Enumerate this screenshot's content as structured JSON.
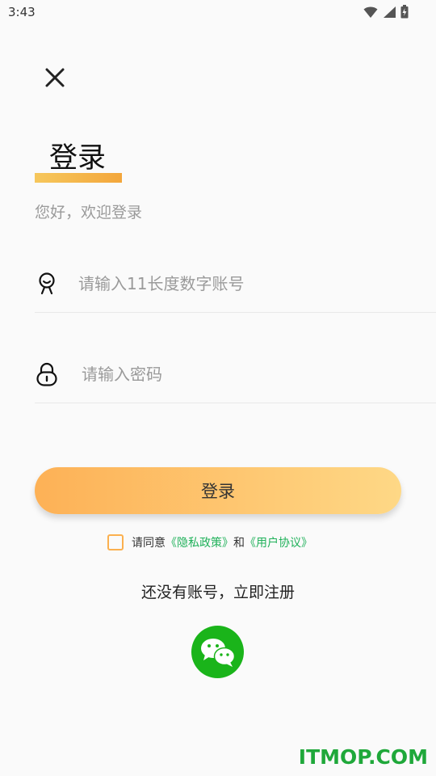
{
  "status_bar": {
    "time": "3:43",
    "icons": [
      "wifi-icon",
      "signal-icon",
      "battery-icon"
    ]
  },
  "header": {
    "close_icon": "close-icon",
    "title": "登录",
    "subtitle": "您好，欢迎登录"
  },
  "form": {
    "account": {
      "icon": "user-icon",
      "placeholder": "请输入11长度数字账号",
      "value": ""
    },
    "password": {
      "icon": "lock-icon",
      "placeholder": "请输入密码",
      "value": ""
    },
    "login_button": "登录"
  },
  "agreement": {
    "checked": false,
    "prefix": "请同意",
    "privacy_link": "《隐私政策》",
    "and": "和",
    "terms_link": "《用户协议》"
  },
  "register_text": "还没有账号，立即注册",
  "social": {
    "wechat_icon": "wechat-icon"
  },
  "watermark": "ITMOP.COM",
  "colors": {
    "accent_start": "#fdb156",
    "accent_end": "#fed886",
    "link": "#20b15a",
    "wechat": "#1ab41a"
  }
}
